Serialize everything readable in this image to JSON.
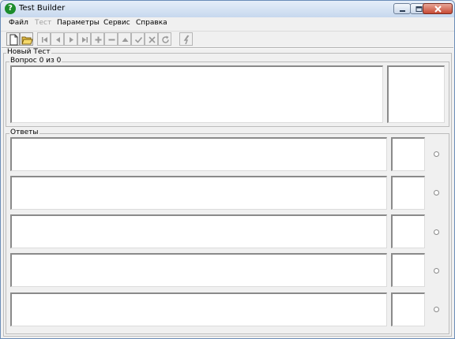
{
  "window": {
    "title": "Test Builder",
    "icon_symbol": "?",
    "controls": {
      "minimize": "minimize-icon",
      "maximize": "maximize-icon",
      "close": "close-icon"
    }
  },
  "menu": {
    "file": "Файл",
    "test": "Тест",
    "parameters": "Параметры",
    "service": "Сервис",
    "help": "Справка"
  },
  "toolbar": {
    "icons": [
      "new-document-icon",
      "open-folder-icon",
      "first-icon",
      "previous-icon",
      "next-icon",
      "last-icon",
      "add-icon",
      "remove-icon",
      "move-up-icon",
      "accept-icon",
      "cancel-icon",
      "refresh-icon",
      "run-test-icon"
    ]
  },
  "test_group": {
    "title": "Новый Тест"
  },
  "question_group": {
    "title": "Вопрос 0 из 0"
  },
  "answers_group": {
    "title": "Ответы"
  },
  "answers": [
    {
      "text": "",
      "score": ""
    },
    {
      "text": "",
      "score": ""
    },
    {
      "text": "",
      "score": ""
    },
    {
      "text": "",
      "score": ""
    },
    {
      "text": "",
      "score": ""
    }
  ],
  "colors": {
    "titlebar": "#c7d8ee",
    "close_button": "#c74a35",
    "app_icon": "#1c8c2c",
    "background": "#f0f0f0"
  }
}
